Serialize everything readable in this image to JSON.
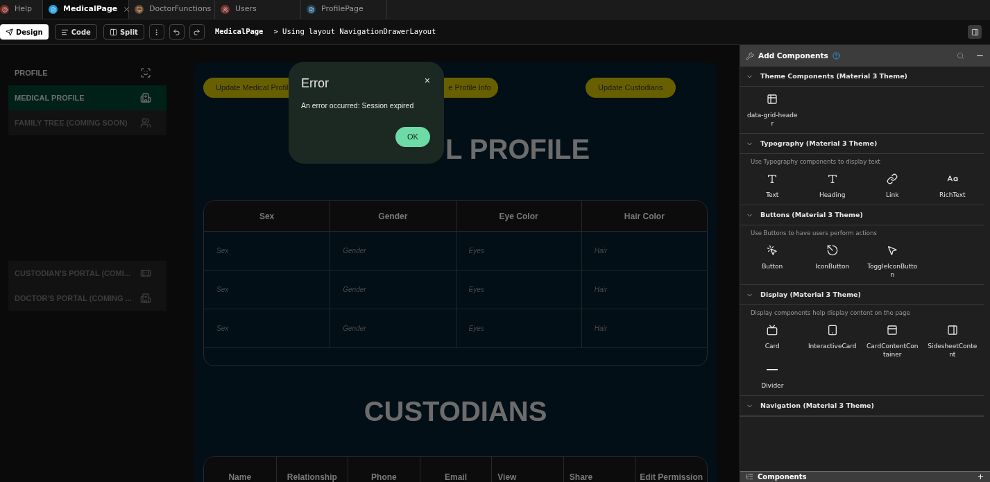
{
  "tabs": [
    {
      "label": "Help",
      "selected": false,
      "color": "#7a2f2a",
      "closable": false
    },
    {
      "label": "MedicalPage",
      "selected": true,
      "color": "#1aa0e6",
      "closable": true
    },
    {
      "label": "DoctorFunctions",
      "selected": false,
      "color": "#6b4a2a",
      "closable": false
    },
    {
      "label": "Users",
      "selected": false,
      "color": "#7a3330",
      "closable": false
    },
    {
      "label": "ProfilePage",
      "selected": false,
      "color": "#1d4a66",
      "closable": false
    }
  ],
  "toolbar": {
    "modes": [
      {
        "label": "Design",
        "selected": true
      },
      {
        "label": "Code",
        "selected": false
      },
      {
        "label": "Split",
        "selected": false
      }
    ],
    "breadcrumb_page": "MedicalPage",
    "breadcrumb_layout": "> Using layout NavigationDrawerLayout"
  },
  "drawer": {
    "groups": [
      [
        {
          "label": "PROFILE",
          "selected": false,
          "disabled": false
        },
        {
          "label": "MEDICAL PROFILE",
          "selected": true,
          "disabled": false
        },
        {
          "label": "FAMILY TREE (COMING SOON)",
          "selected": false,
          "disabled": true
        }
      ],
      [
        {
          "label": "CUSTODIAN'S PORTAL (COMI...",
          "selected": false,
          "disabled": true
        },
        {
          "label": "DOCTOR'S PORTAL (COMING ...",
          "selected": false,
          "disabled": true
        }
      ]
    ]
  },
  "page": {
    "actions": [
      "Update Medical Profil",
      "e Profile Info",
      "Update Custodians"
    ],
    "medical_heading": "L PROFILE",
    "medical_table": {
      "columns": [
        "Sex",
        "Gender",
        "Eye Color",
        "Hair Color"
      ],
      "rows": [
        [
          {
            "placeholder": "Sex"
          },
          {
            "placeholder": "Gender"
          },
          {
            "placeholder": "Eyes"
          },
          {
            "placeholder": "Hair"
          }
        ],
        [
          {
            "placeholder": "Sex"
          },
          {
            "placeholder": "Gender"
          },
          {
            "placeholder": "Eyes"
          },
          {
            "placeholder": "Hair"
          }
        ],
        [
          {
            "placeholder": "Sex"
          },
          {
            "placeholder": "Gender"
          },
          {
            "placeholder": "Eyes"
          },
          {
            "placeholder": "Hair"
          }
        ]
      ]
    },
    "custodians_heading": "CUSTODIANS",
    "custodians_table": {
      "columns": [
        "Name",
        "Relationship",
        "Phone",
        "Email",
        "View",
        "Share",
        "Edit Permission"
      ]
    }
  },
  "dialog": {
    "title": "Error",
    "close": "×",
    "message": "An error occurred: Session expired",
    "button": "OK"
  },
  "panel": {
    "title": "Add Components",
    "sections": [
      {
        "title": "Theme Components (Material 3 Theme)",
        "expanded": true,
        "items": [
          "data-grid-header"
        ]
      },
      {
        "title": "Typography (Material 3 Theme)",
        "expanded": true,
        "description": "Use Typography components to display text",
        "items": [
          "Text",
          "Heading",
          "Link",
          "RichText"
        ]
      },
      {
        "title": "Buttons (Material 3 Theme)",
        "expanded": true,
        "description": "Use Buttons to have users perform actions",
        "items": [
          "Button",
          "IconButton",
          "ToggleIconButton"
        ]
      },
      {
        "title": "Display (Material 3 Theme)",
        "expanded": true,
        "description": "Display components help display content on the page",
        "items": [
          "Card",
          "InteractiveCard",
          "CardContentContainer",
          "SidesheetContent",
          "Divider"
        ]
      },
      {
        "title": "Navigation (Material 3 Theme)",
        "expanded": true
      }
    ],
    "footer_title": "Components"
  }
}
